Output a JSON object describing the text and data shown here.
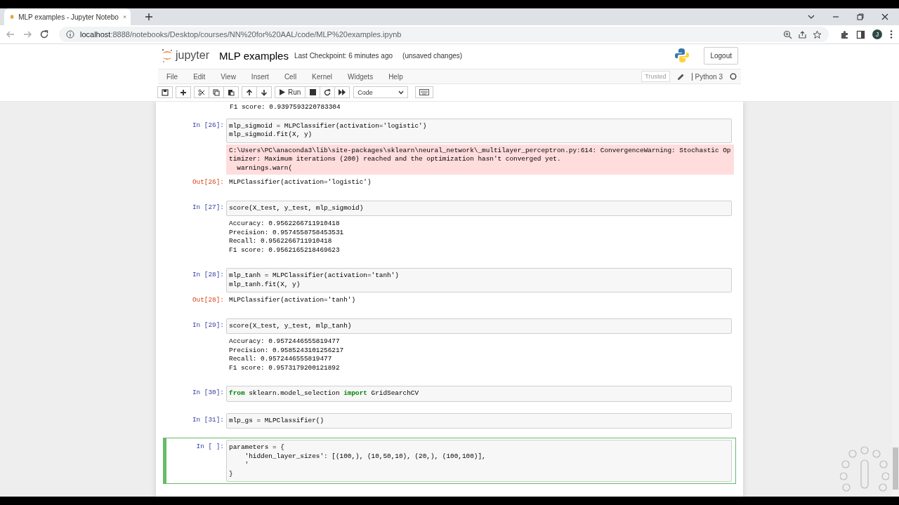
{
  "browser": {
    "tab_title": "MLP examples - Jupyter Notebo",
    "url_host": "localhost",
    "url_rest": ":8888/notebooks/Desktop/courses/NN%20for%20AAL/code/MLP%20examples.ipynb",
    "profile": "J"
  },
  "notebook": {
    "logo_text": "jupyter",
    "name": "MLP examples",
    "checkpoint": "Last Checkpoint: 6 minutes ago",
    "unsaved": "(unsaved changes)",
    "logout": "Logout",
    "menu": [
      "File",
      "Edit",
      "View",
      "Insert",
      "Cell",
      "Kernel",
      "Widgets",
      "Help"
    ],
    "toolbar": {
      "run": "Run",
      "cell_type": "Code",
      "trusted": "Trusted",
      "kernel": "Python 3"
    }
  },
  "top_cut_output": "F1 score: 0.9397593220783304",
  "cells": [
    {
      "prompt": "In [26]:",
      "active": false,
      "code": [
        "mlp_sigmoid = MLPClassifier(activation='logistic')",
        "mlp_sigmoid.fit(X, y)"
      ],
      "outputs": [
        {
          "kind": "stderr",
          "lines": [
            "C:\\Users\\PC\\anaconda3\\lib\\site-packages\\sklearn\\neural_network\\_multilayer_perceptron.py:614: ConvergenceWarning: Stochastic Op",
            "timizer: Maximum iterations (200) reached and the optimization hasn't converged yet.",
            "  warnings.warn("
          ]
        },
        {
          "kind": "result",
          "prompt": "Out[26]:",
          "lines": [
            "MLPClassifier(activation='logistic')"
          ]
        }
      ]
    },
    {
      "prompt": "In [27]:",
      "active": false,
      "code": [
        "score(X_test, y_test, mlp_sigmoid)"
      ],
      "outputs": [
        {
          "kind": "stream",
          "lines": [
            "Accuracy: 0.9562266711910418",
            "Precision: 0.9574558758453531",
            "Recall: 0.9562266711910418",
            "F1 score: 0.9562165218469623"
          ]
        }
      ]
    },
    {
      "prompt": "In [28]:",
      "active": false,
      "code": [
        "mlp_tanh = MLPClassifier(activation='tanh')",
        "mlp_tanh.fit(X, y)"
      ],
      "outputs": [
        {
          "kind": "result",
          "prompt": "Out[28]:",
          "lines": [
            "MLPClassifier(activation='tanh')"
          ]
        }
      ]
    },
    {
      "prompt": "In [29]:",
      "active": false,
      "code": [
        "score(X_test, y_test, mlp_tanh)"
      ],
      "outputs": [
        {
          "kind": "stream",
          "lines": [
            "Accuracy: 0.9572446555819477",
            "Precision: 0.9585243101256217",
            "Recall: 0.9572446555819477",
            "F1 score: 0.9573179200121892"
          ]
        }
      ]
    },
    {
      "prompt": "In [30]:",
      "active": false,
      "code": [
        "**from** sklearn.model_selection **import** GridSearchCV"
      ]
    },
    {
      "prompt": "In [31]:",
      "active": false,
      "code": [
        "mlp_gs = MLPClassifier()"
      ]
    },
    {
      "prompt": "In [ ]:",
      "active": true,
      "code": [
        "parameters = {",
        "    'hidden_layer_sizes': [(100,), (10,50,10), (20,), (100,100)],",
        "    '",
        "}"
      ]
    }
  ]
}
